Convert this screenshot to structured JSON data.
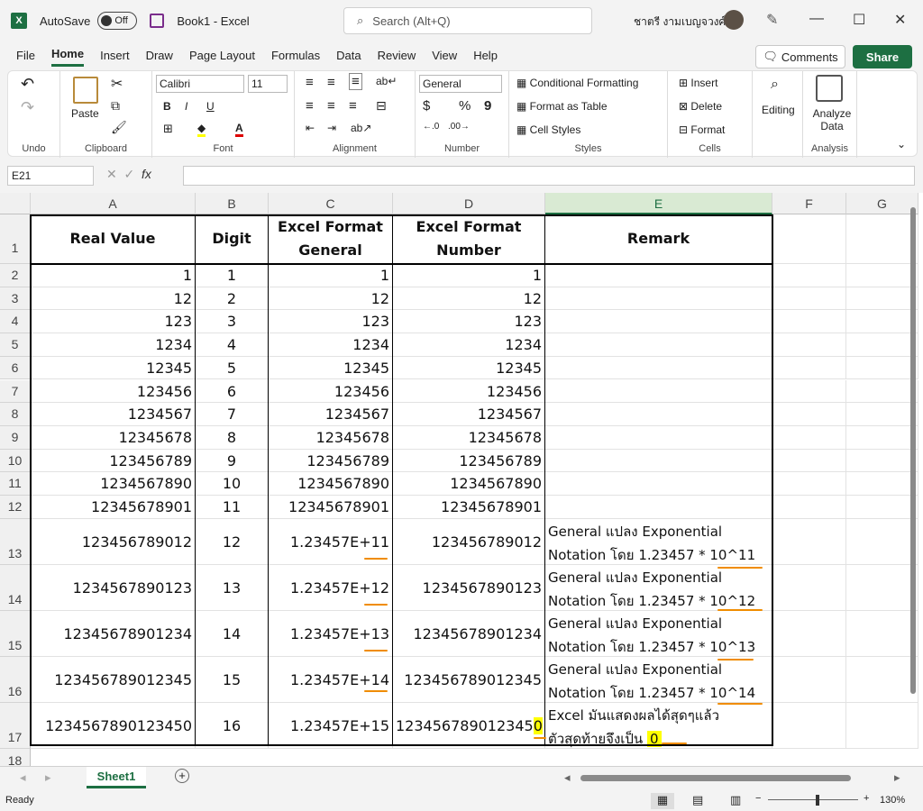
{
  "titlebar": {
    "app_logo": "X",
    "autosave_label": "AutoSave",
    "autosave_state": "Off",
    "document_title": "Book1  -  Excel",
    "search_placeholder": "Search (Alt+Q)",
    "user_name": "ชาตรี งามเบญจวงศ์",
    "minimize": "—",
    "maximize": "☐",
    "close": "✕"
  },
  "menu": {
    "tabs": [
      "File",
      "Home",
      "Insert",
      "Draw",
      "Page Layout",
      "Formulas",
      "Data",
      "Review",
      "View",
      "Help"
    ],
    "active": "Home",
    "comments_label": "Comments",
    "share_label": "Share"
  },
  "ribbon": {
    "undo_group": "Undo",
    "paste_label": "Paste",
    "clipboard_group": "Clipboard",
    "font_name": "Calibri",
    "font_size": "11",
    "bold": "B",
    "italic": "I",
    "underline": "U",
    "font_color_glyph": "A",
    "font_group": "Font",
    "alignment_group": "Alignment",
    "number_format": "General",
    "currency_glyph": "$",
    "percent_glyph": "%",
    "comma_glyph": "9",
    "number_group": "Number",
    "conditional_formatting": "Conditional Formatting",
    "format_as_table": "Format as Table",
    "cell_styles": "Cell Styles",
    "styles_group": "Styles",
    "insert": "Insert",
    "delete": "Delete",
    "format": "Format",
    "cells_group": "Cells",
    "editing": "Editing",
    "analyze_data": "Analyze Data",
    "analysis_group": "Analysis"
  },
  "formula_bar": {
    "name_box": "E21",
    "fx": "fx",
    "cancel_glyph": "✕",
    "enter_glyph": "✓"
  },
  "columns": [
    "A",
    "B",
    "C",
    "D",
    "E",
    "F",
    "G"
  ],
  "headers": {
    "a": "Real Value",
    "b": "Digit",
    "c": "Excel Format General",
    "d": "Excel Format Number",
    "e": "Remark"
  },
  "rows": [
    {
      "n": "2",
      "a": "1",
      "b": "1",
      "c": "1",
      "d": "1",
      "e": ""
    },
    {
      "n": "3",
      "a": "12",
      "b": "2",
      "c": "12",
      "d": "12",
      "e": ""
    },
    {
      "n": "4",
      "a": "123",
      "b": "3",
      "c": "123",
      "d": "123",
      "e": ""
    },
    {
      "n": "5",
      "a": "1234",
      "b": "4",
      "c": "1234",
      "d": "1234",
      "e": ""
    },
    {
      "n": "6",
      "a": "12345",
      "b": "5",
      "c": "12345",
      "d": "12345",
      "e": ""
    },
    {
      "n": "7",
      "a": "123456",
      "b": "6",
      "c": "123456",
      "d": "123456",
      "e": ""
    },
    {
      "n": "8",
      "a": "1234567",
      "b": "7",
      "c": "1234567",
      "d": "1234567",
      "e": ""
    },
    {
      "n": "9",
      "a": "12345678",
      "b": "8",
      "c": "12345678",
      "d": "12345678",
      "e": ""
    },
    {
      "n": "10",
      "a": "123456789",
      "b": "9",
      "c": "123456789",
      "d": "123456789",
      "e": ""
    },
    {
      "n": "11",
      "a": "1234567890",
      "b": "10",
      "c": "1234567890",
      "d": "1234567890",
      "e": ""
    },
    {
      "n": "12",
      "a": "12345678901",
      "b": "11",
      "c": "12345678901",
      "d": "12345678901",
      "e": ""
    },
    {
      "n": "13",
      "a": "123456789012",
      "b": "12",
      "c": "1.23457E+11",
      "d": "123456789012",
      "e": "General แปลง Exponential Notation โดย 1.23457 * 10^11"
    },
    {
      "n": "14",
      "a": "1234567890123",
      "b": "13",
      "c": "1.23457E+12",
      "d": "1234567890123",
      "e": "General แปลง Exponential Notation โดย 1.23457 * 10^12"
    },
    {
      "n": "15",
      "a": "12345678901234",
      "b": "14",
      "c": "1.23457E+13",
      "d": "12345678901234",
      "e": "General แปลง Exponential Notation โดย 1.23457 * 10^13"
    },
    {
      "n": "16",
      "a": "123456789012345",
      "b": "15",
      "c": "1.23457E+14",
      "d": "123456789012345",
      "e": "General แปลง Exponential Notation โดย 1.23457 * 10^14"
    },
    {
      "n": "17",
      "a": "1234567890123450",
      "b": "16",
      "c": "1.23457E+15",
      "d": "123456789012345",
      "d_hl": "0",
      "e_line1": "Excel มันแสดงผลได้สุดๆแล้ว",
      "e_line2": "ตัวสุดท้ายจึงเป็น",
      "e_hl": "0"
    }
  ],
  "row_numbers": {
    "r1": "1",
    "r18": "18"
  },
  "sheet": {
    "tab": "Sheet1",
    "add_glyph": "+"
  },
  "status": {
    "ready": "Ready",
    "zoom": "130%",
    "zoom_minus": "−",
    "zoom_plus": "+"
  },
  "colors": {
    "accent": "#1d6f42",
    "underline_marker": "#f08c00",
    "highlight": "#ffff00"
  }
}
